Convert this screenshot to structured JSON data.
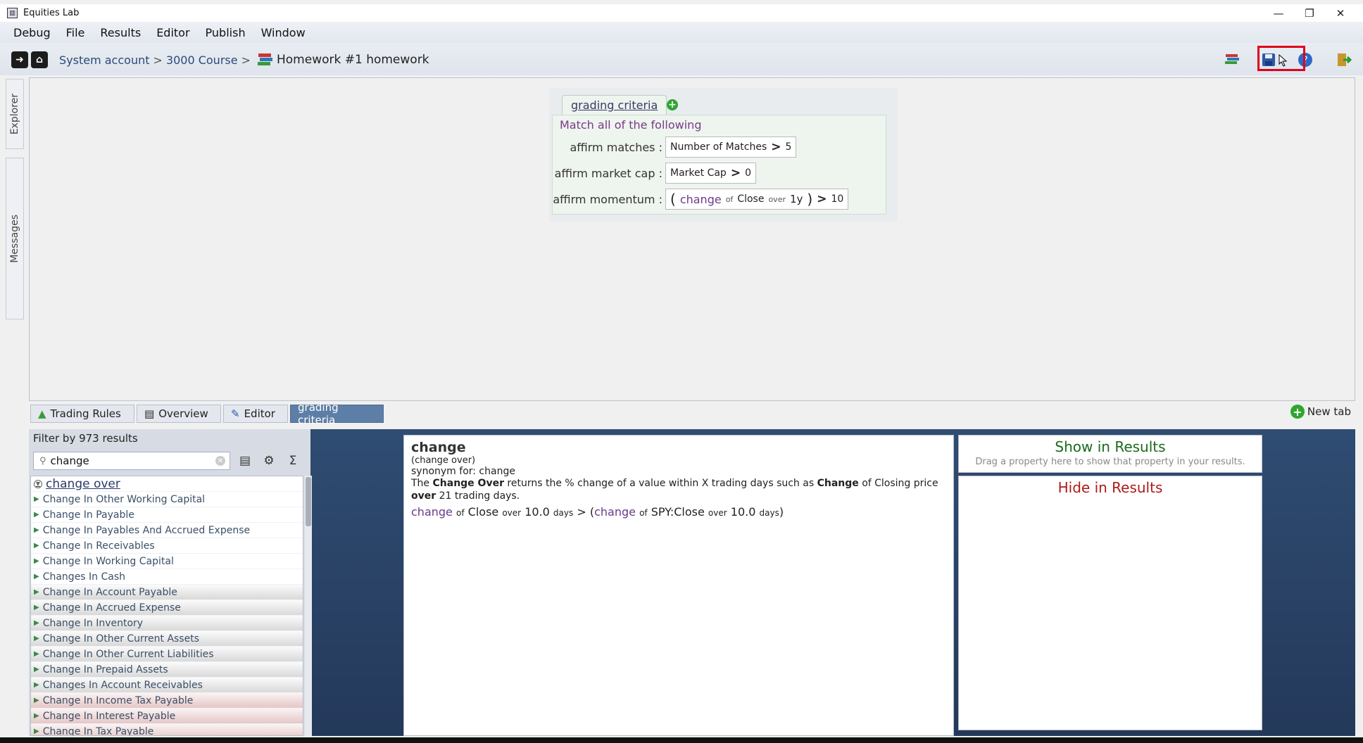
{
  "window": {
    "title": "Equities Lab"
  },
  "menu": [
    "Debug",
    "File",
    "Results",
    "Editor",
    "Publish",
    "Window"
  ],
  "breadcrumb": {
    "account": "System account",
    "separator": ">",
    "course": "3000 Course",
    "homework": "Homework #1 homework"
  },
  "side_tabs": {
    "explorer": "Explorer",
    "messages": "Messages"
  },
  "criteria": {
    "tab_label": "grading criteria",
    "match_all": "Match all of the following",
    "rules": [
      {
        "label": "affirm matches",
        "field": "Number of Matches",
        "op": ">",
        "value": "5"
      },
      {
        "label": "affirm market cap",
        "field": "Market Cap",
        "op": ">",
        "value": "0"
      },
      {
        "label": "affirm momentum",
        "open": "(",
        "fn": "change",
        "of": "of",
        "field": "Close",
        "over": "over",
        "period": "1y",
        "close": ")",
        "op": ">",
        "value": "10"
      }
    ],
    "rule_colon": ":"
  },
  "tabs": [
    "Trading Rules",
    "Overview",
    "Editor",
    "grading criteria"
  ],
  "new_tab": "New tab",
  "filter": {
    "title": "Filter by 973 results",
    "search_value": "change",
    "results": [
      "change over",
      "Change In Other Working Capital",
      "Change In Payable",
      "Change In Payables And Accrued Expense",
      "Change In Receivables",
      "Change In Working Capital",
      "Changes In Cash",
      "Change In Account Payable",
      "Change In Accrued Expense",
      "Change In Inventory",
      "Change In Other Current Assets",
      "Change In Other Current Liabilities",
      "Change In Prepaid Assets",
      "Changes In Account Receivables",
      "Change In Income Tax Payable",
      "Change In Interest Payable",
      "Change In Tax Payable"
    ]
  },
  "description": {
    "title": "change",
    "subtitle": "(change over)",
    "synonym": "synonym for: change",
    "body_pre": "The ",
    "body_bold1": "Change Over",
    "body_mid": " returns the % change of a value within X trading days such as ",
    "body_bold2": "Change",
    "body_mid2": " of Closing price ",
    "body_bold3": "over",
    "body_post": " 21 trading days.",
    "example": {
      "fn1": "change",
      "of1": "of",
      "field1": "Close",
      "over1": "over",
      "num1": "10.0",
      "days1": "days",
      "op": ">",
      "open": "(",
      "fn2": "change",
      "of2": "of",
      "field2": "SPY:Close",
      "over2": "over",
      "num2": "10.0",
      "days2": "days",
      "close": ")"
    }
  },
  "show_results": {
    "title": "Show in Results",
    "hint": "Drag a property here to show that property in your results."
  },
  "hide_results": {
    "title": "Hide in Results"
  }
}
